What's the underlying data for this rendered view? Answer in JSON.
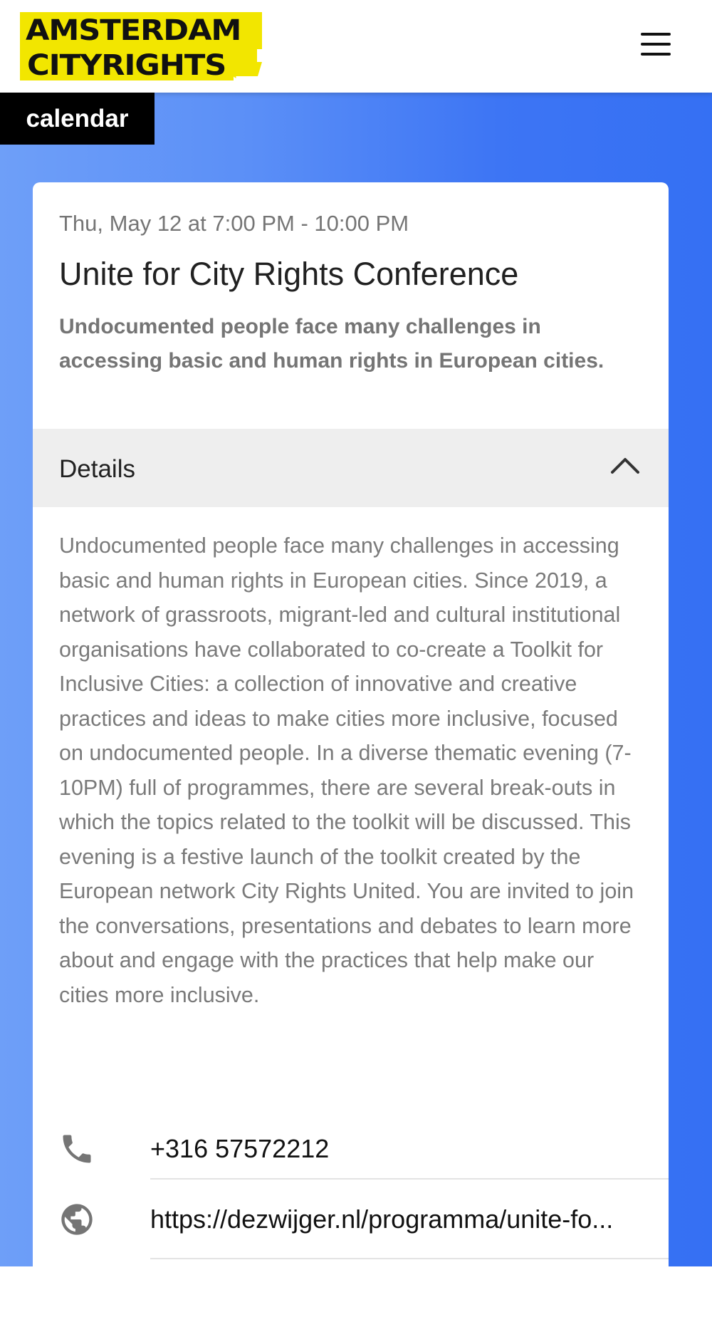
{
  "header": {
    "logo_line1": "AMSTERDAM",
    "logo_line2": "CITYRIGHTS",
    "menu_icon": "hamburger-menu-icon"
  },
  "section_tag": "calendar",
  "event": {
    "datetime": "Thu, May 12 at 7:00 PM - 10:00 PM",
    "title": "Unite for City Rights Conference",
    "summary": "Undocumented people face many challenges in accessing basic and human rights in European cities.",
    "details_label": "Details",
    "details_expanded": true,
    "description": "Undocumented people face many challenges in accessing basic and human rights in European cities. Since 2019, a network of grassroots, migrant-led and cultural institutional organisations have collaborated to co-create a Toolkit for Inclusive Cities: a collection of innovative and creative practices and ideas to make cities more inclusive, focused on undocumented people. In a diverse thematic evening (7-10PM) full of programmes, there are several break-outs in which the topics related to the toolkit will be discussed. This evening is a festive launch of the toolkit created by the European network City Rights United. You are invited to join the conversations, presentations and debates to learn more about and engage with the practices that help make our cities more inclusive.",
    "phone": "+316 57572212",
    "website": "https://dezwijger.nl/programma/unite-fo..."
  },
  "colors": {
    "logo_yellow": "#f2e600",
    "tag_bg": "#000000",
    "gradient_left": "#6e9ff8",
    "gradient_right": "#3570f3"
  }
}
